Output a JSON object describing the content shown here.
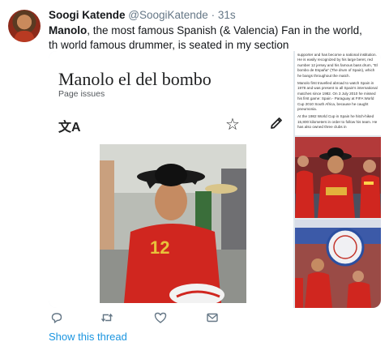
{
  "tweet": {
    "display_name": "Soogi Katende",
    "handle": "@SoogiKatende",
    "separator": "·",
    "time": "31s",
    "text_bold": "Manolo",
    "text_rest": ", the most famous Spanish (& Valencia) Fan in the world, th world famous drummer, is seated in my section"
  },
  "wiki": {
    "title": "Manolo el del bombo",
    "subtitle": "Page issues",
    "translate_icon_text": "文A"
  },
  "side_article": {
    "p1": "supporter and has become a national institution. He is easily recognized by his large beret, red number 12 jersey and his famous bass drum, \"El bombo de España\" (The drum of Spain), which he bangs throughout the match.",
    "p2": "Manolo first travelled abroad to watch Spain in 1978 and was present to all Spain's international matches since 1982. On 3 July 2010 he missed his first game: Spain - Paraguay at FIFA World Cup 2010 South Africa, because he caught pneumonia.",
    "p3": "At the 1982 World Cup in Spain he hitch-hiked 15,800 kilometers in order to follow his team. He has also owned three clubs in"
  },
  "actions": {
    "reply_icon": "reply-icon",
    "retweet_icon": "retweet-icon",
    "like_icon": "heart-icon",
    "dm_icon": "envelope-icon"
  },
  "show_thread": "Show this thread",
  "colors": {
    "link": "#1b95e0",
    "secondary_text": "#657786",
    "jersey_red": "#d0261f",
    "beret": "#1a1a1a"
  }
}
